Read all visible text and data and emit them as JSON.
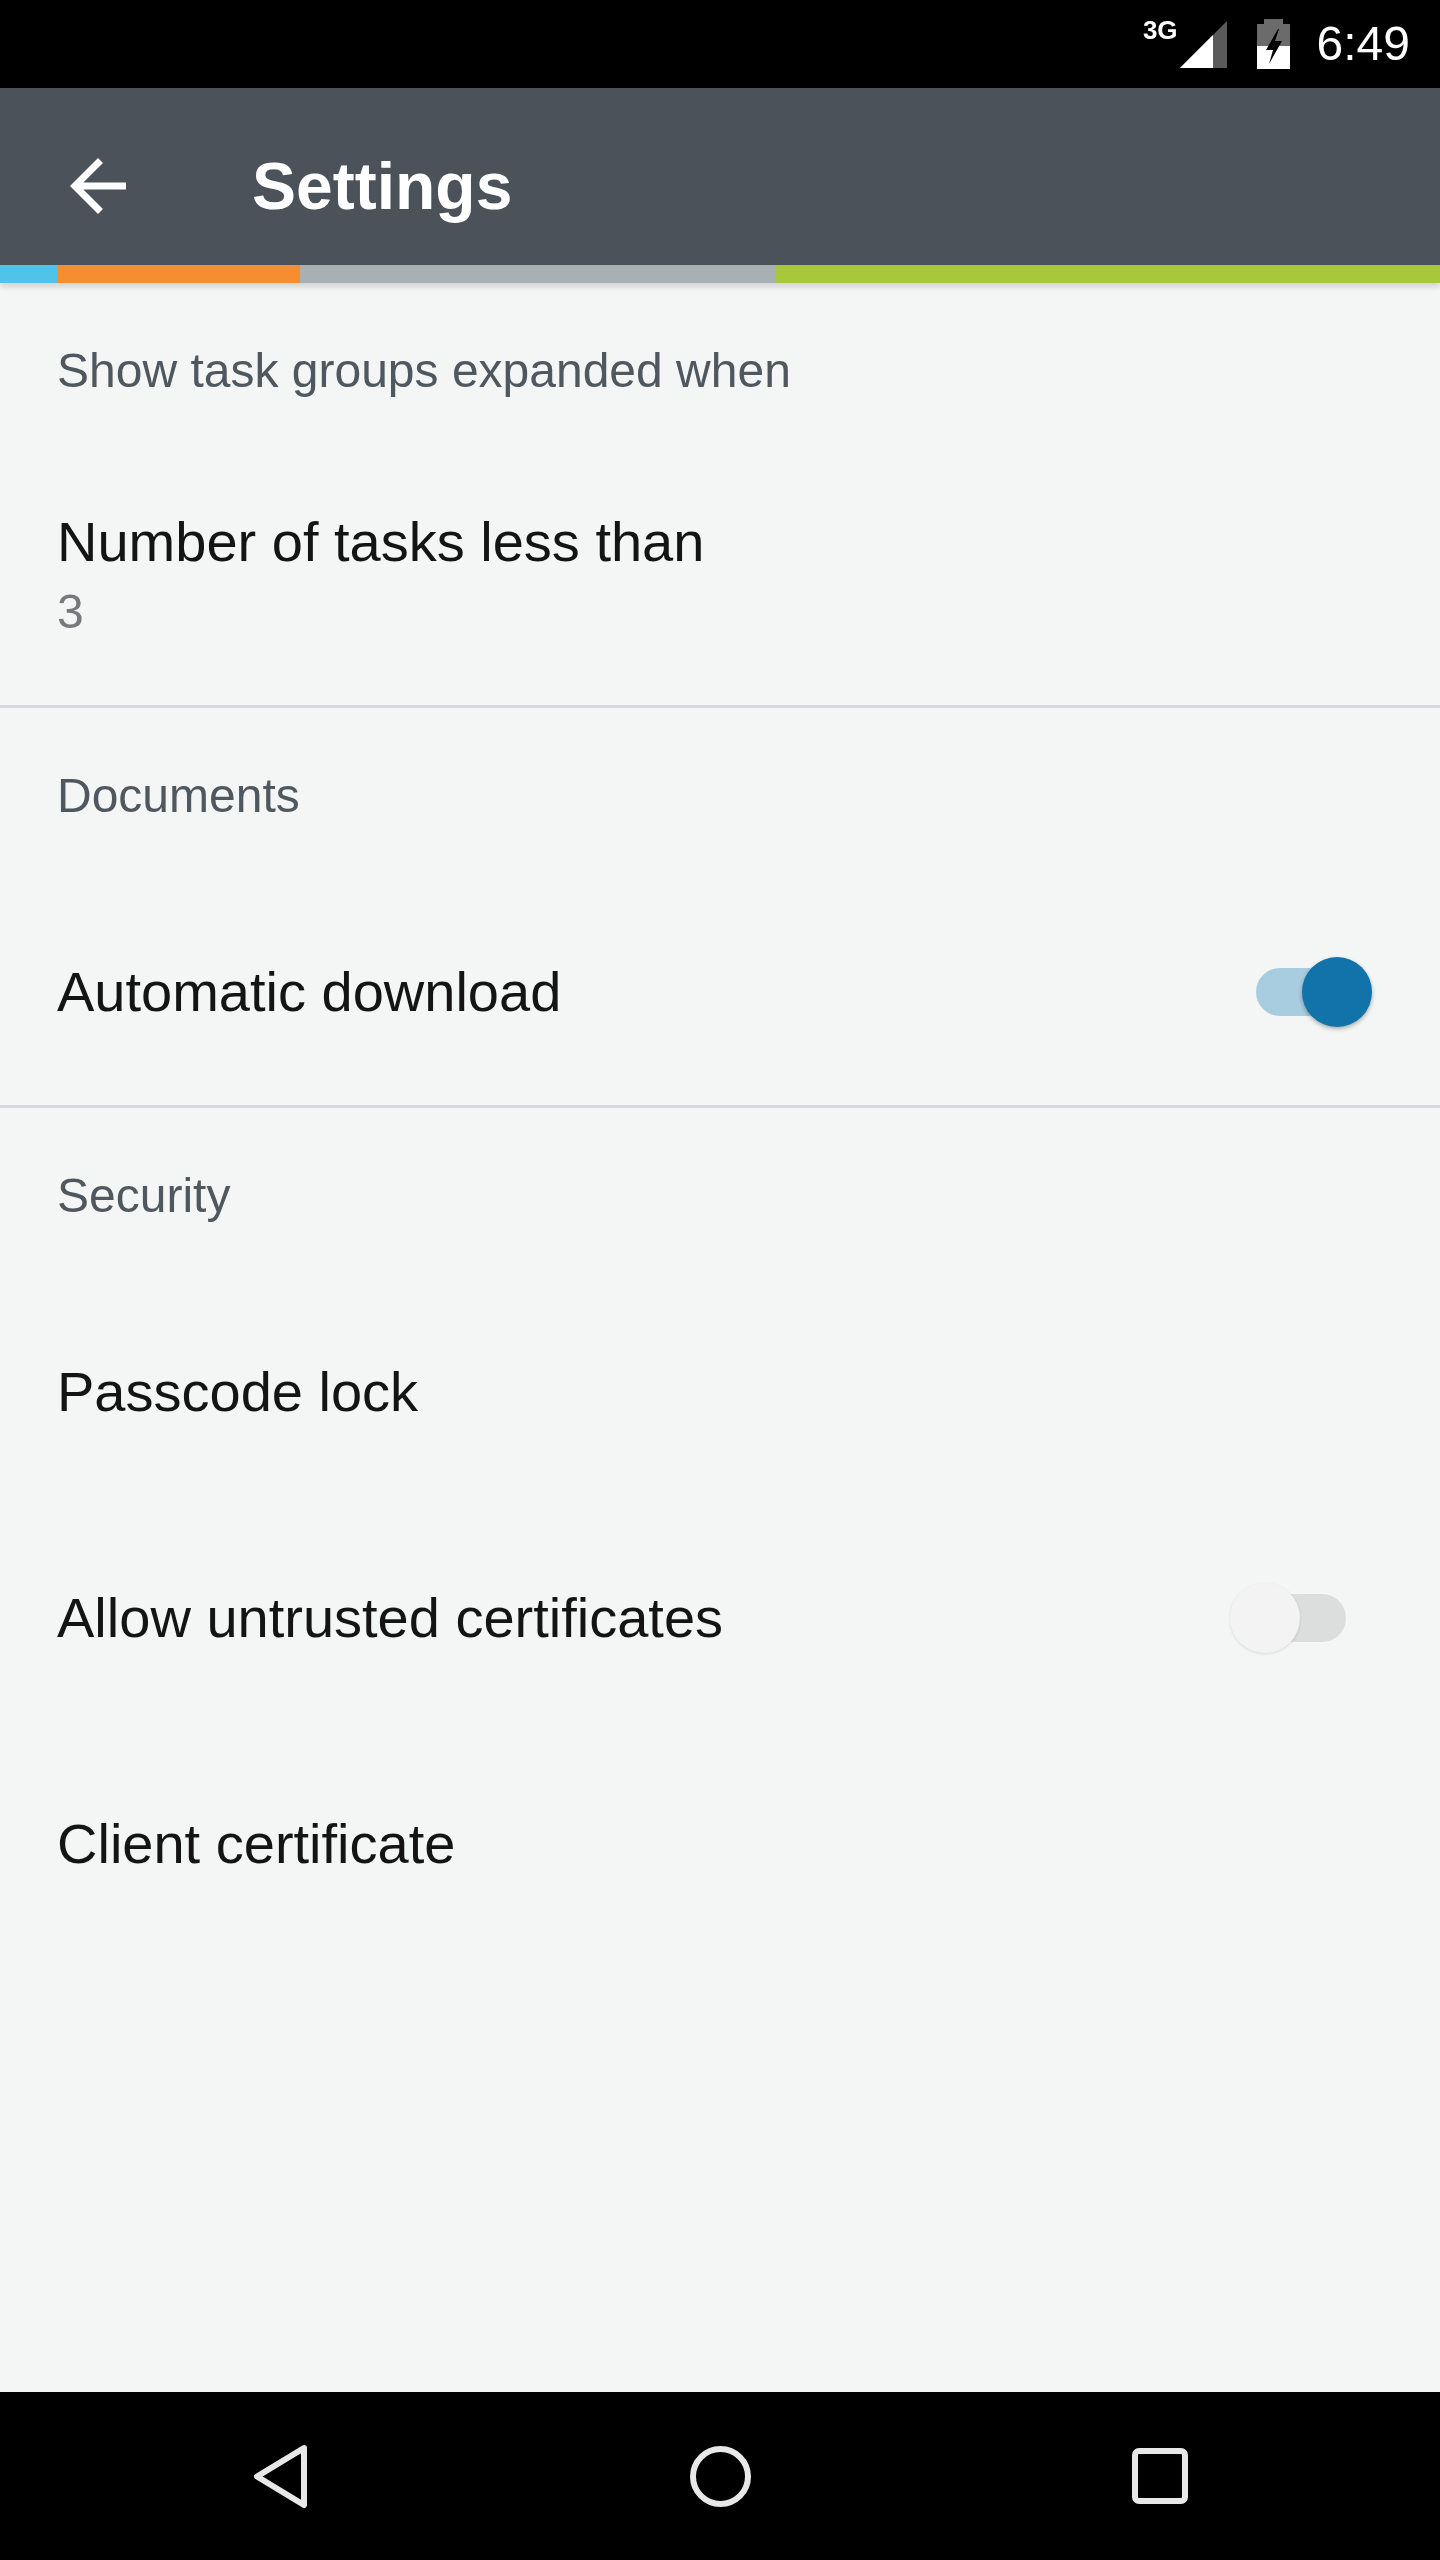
{
  "status_bar": {
    "network": "3G",
    "time": "6:49"
  },
  "app_bar": {
    "title": "Settings"
  },
  "sections": [
    {
      "title": "Show task groups expanded when",
      "items": [
        {
          "kind": "value",
          "label": "Number of tasks less than",
          "value": "3"
        }
      ]
    },
    {
      "title": "Documents",
      "items": [
        {
          "kind": "switch",
          "label": "Automatic download",
          "on": true
        }
      ]
    },
    {
      "title": "Security",
      "items": [
        {
          "kind": "plain",
          "label": "Passcode lock"
        },
        {
          "kind": "switch",
          "label": "Allow untrusted certificates",
          "on": false
        },
        {
          "kind": "plain",
          "label": "Client certificate"
        }
      ]
    }
  ]
}
